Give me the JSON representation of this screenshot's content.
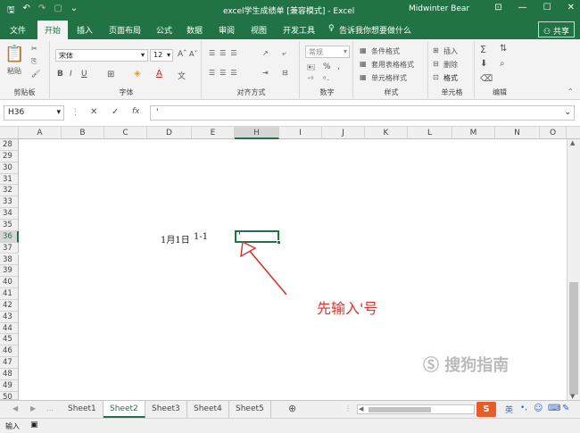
{
  "title_bar": {
    "title": "excel学生成绩单  [兼容模式]  -  Excel",
    "user": "Midwinter Bear"
  },
  "ribbon_tabs": [
    "文件",
    "开始",
    "插入",
    "页面布局",
    "公式",
    "数据",
    "审阅",
    "视图",
    "开发工具"
  ],
  "tell_me": "告诉我你想要做什么",
  "share_label": "共享",
  "ribbon": {
    "clipboard": {
      "paste": "粘贴",
      "label": "剪贴板"
    },
    "font": {
      "name": "宋体",
      "size": "12",
      "label": "字体"
    },
    "alignment": {
      "label": "对齐方式"
    },
    "number": {
      "format": "常规",
      "percent": "%",
      "comma": ",",
      "label": "数字"
    },
    "styles": {
      "conditional": "条件格式",
      "table": "套用表格格式",
      "cell": "单元格样式",
      "label": "样式"
    },
    "cells": {
      "insert": "插入",
      "delete": "删除",
      "format": "格式",
      "label": "单元格"
    },
    "editing": {
      "label": "编辑"
    }
  },
  "formula_bar": {
    "name_box": "H36",
    "fx": "fx",
    "formula": "'"
  },
  "columns": [
    "A",
    "B",
    "C",
    "D",
    "E",
    "H",
    "I",
    "J",
    "K",
    "L",
    "M",
    "N",
    "O"
  ],
  "rows": [
    "28",
    "29",
    "30",
    "31",
    "32",
    "33",
    "34",
    "35",
    "36",
    "37",
    "38",
    "39",
    "40",
    "41",
    "42",
    "43",
    "44",
    "45",
    "46",
    "47",
    "48",
    "49",
    "50"
  ],
  "cells": {
    "d36": "1月1日",
    "e36": "1-1",
    "h36": "'"
  },
  "annotation": "先输入'号",
  "sheet_tabs": [
    "Sheet1",
    "Sheet2",
    "Sheet3",
    "Sheet4",
    "Sheet5"
  ],
  "active_sheet": "Sheet2",
  "status_bar": {
    "mode": "输入"
  },
  "watermark": "搜狗指南",
  "colors": {
    "accent": "#217346",
    "annotation": "#d9332e"
  }
}
